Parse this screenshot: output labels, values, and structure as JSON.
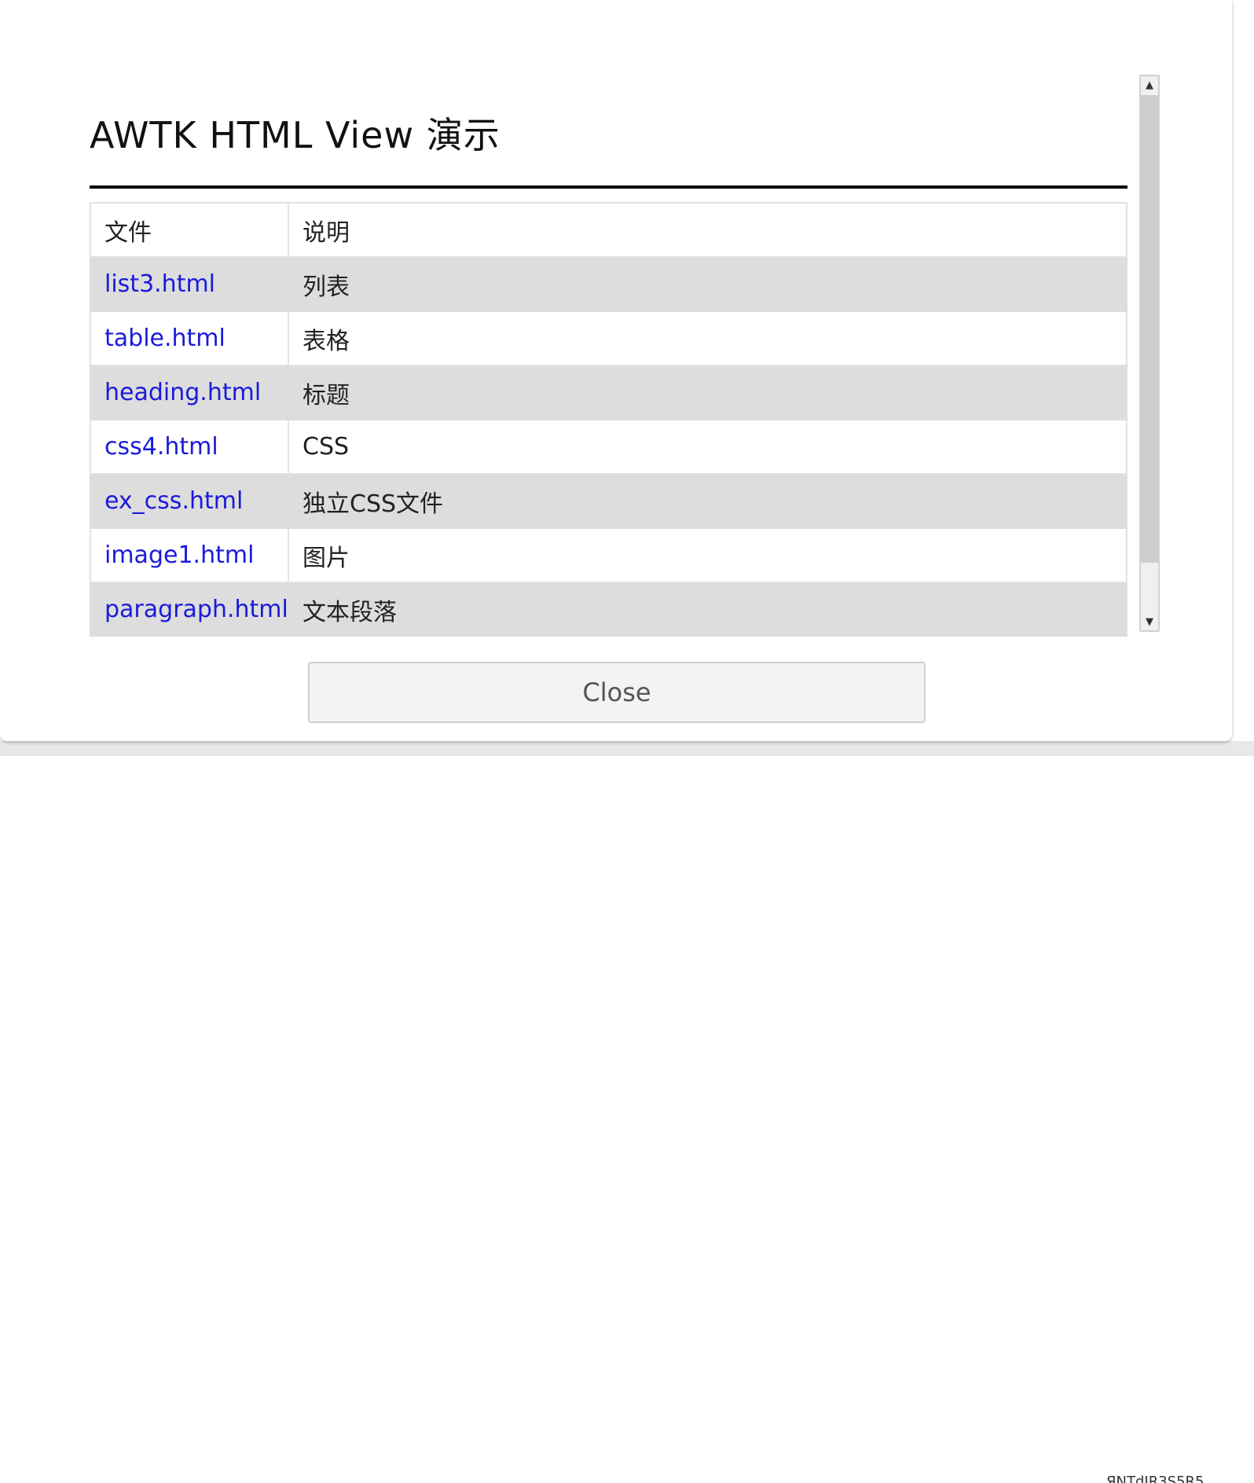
{
  "page": {
    "title": "AWTK HTML View 演示"
  },
  "table": {
    "header": [
      "文件",
      "说明"
    ],
    "rows": [
      {
        "file": "list3.html",
        "desc": "列表"
      },
      {
        "file": "table.html",
        "desc": "表格"
      },
      {
        "file": "heading.html",
        "desc": "标题"
      },
      {
        "file": "css4.html",
        "desc": "CSS"
      },
      {
        "file": "ex_css.html",
        "desc": "独立CSS文件"
      },
      {
        "file": "image1.html",
        "desc": "图片"
      },
      {
        "file": "paragraph.html",
        "desc": "文本段落"
      }
    ]
  },
  "scrollbar": {
    "up_icon": "triangle-up-icon",
    "down_icon": "triangle-down-icon",
    "up_glyph": "▲",
    "down_glyph": "▼"
  },
  "footer": {
    "close_label": "Close"
  },
  "background_window": {
    "partial_text": "ЯNTdIR3S5R5"
  },
  "colors": {
    "link": "#1a1adc",
    "row_alt": "#dddddd",
    "rule": "#000000"
  }
}
